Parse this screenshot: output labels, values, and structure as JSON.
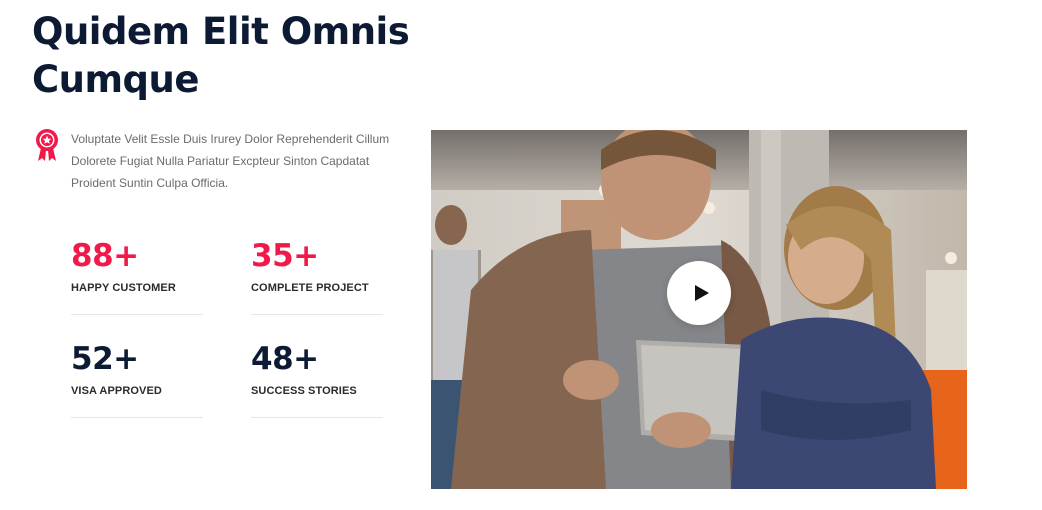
{
  "heading": {
    "title": "Quidem Elit Omnis Cumque"
  },
  "intro": {
    "icon": "award-ribbon-icon",
    "text": "Voluptate Velit Essle Duis Irurey Dolor Reprehenderit Cillum Dolorete Fugiat Nulla Pariatur Excpteur Sinton Capdatat Proident Suntin Culpa Officia."
  },
  "stats": [
    {
      "value": "88+",
      "label": "HAPPY CUSTOMER",
      "color": "#f0194a"
    },
    {
      "value": "35+",
      "label": "COMPLETE PROJECT",
      "color": "#f0194a"
    },
    {
      "value": "52+",
      "label": "VISA APPROVED",
      "color": "#0c1a33"
    },
    {
      "value": "48+",
      "label": "SUCCESS STORIES",
      "color": "#0c1a33"
    }
  ],
  "video": {
    "play_icon": "play-icon",
    "description_icon": "video-thumbnail"
  },
  "colors": {
    "accent": "#f0194a",
    "heading": "#0c1a33",
    "body_text": "#6b6b6b"
  }
}
